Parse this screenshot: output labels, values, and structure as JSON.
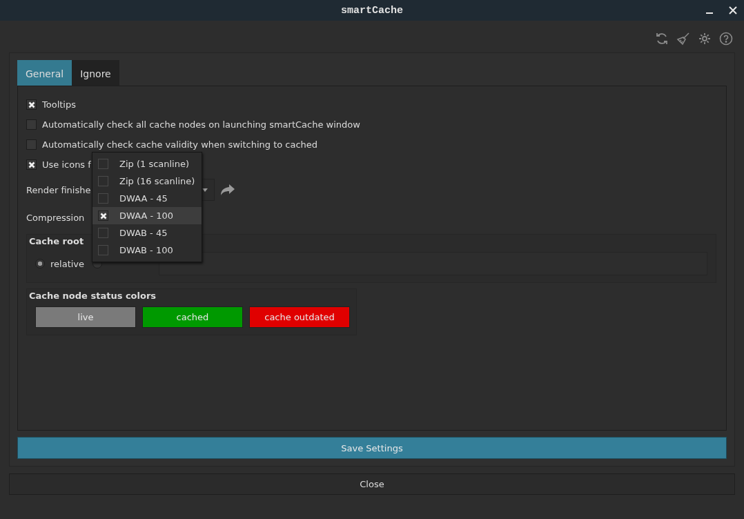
{
  "window": {
    "title": "smartCache"
  },
  "tabs": [
    {
      "label": "General",
      "selected": true
    },
    {
      "label": "Ignore",
      "selected": false
    }
  ],
  "options": [
    {
      "label": "Tooltips",
      "checked": true
    },
    {
      "label": "Automatically check all cache nodes on launching smartCache window",
      "checked": false
    },
    {
      "label": "Automatically check cache validity when switching to cached",
      "checked": false
    },
    {
      "label": "Use icons f",
      "checked": true
    }
  ],
  "render_finished": {
    "label": "Render finishe"
  },
  "compression": {
    "label": "Compression",
    "options": [
      {
        "label": "Zip (1 scanline)",
        "checked": false,
        "selected": false
      },
      {
        "label": "Zip (16 scanline)",
        "checked": false,
        "selected": false
      },
      {
        "label": "DWAA - 45",
        "checked": false,
        "selected": false
      },
      {
        "label": "DWAA - 100",
        "checked": true,
        "selected": true
      },
      {
        "label": "DWAB - 45",
        "checked": false,
        "selected": false
      },
      {
        "label": "DWAB - 100",
        "checked": false,
        "selected": false
      }
    ]
  },
  "cache_root": {
    "title": "Cache root",
    "modes": [
      {
        "label": "relative",
        "selected": true
      },
      {
        "selected": false
      }
    ]
  },
  "status_colors": {
    "title": "Cache node status colors",
    "items": [
      {
        "label": "live",
        "color": "#7a7a7a"
      },
      {
        "label": "cached",
        "color": "#009900"
      },
      {
        "label": "cache outdated",
        "color": "#e00000"
      }
    ]
  },
  "save_button": "Save Settings",
  "close_button": "Close"
}
